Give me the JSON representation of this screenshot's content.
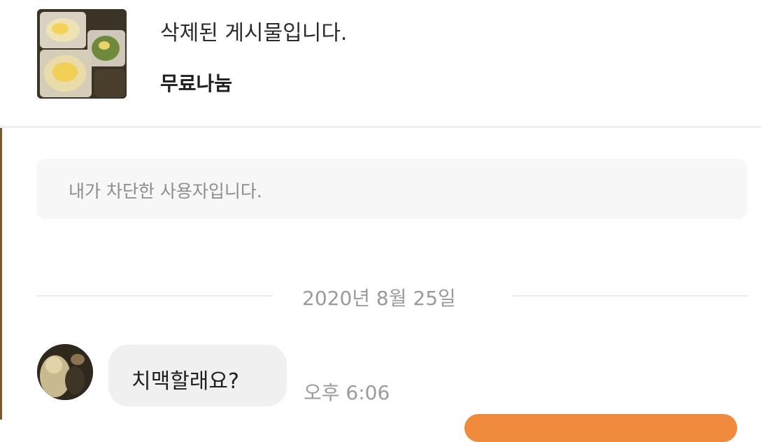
{
  "product": {
    "title": "삭제된 게시물입니다.",
    "price": "무료나눔"
  },
  "notice": {
    "blocked_text": "내가 차단한 사용자입니다."
  },
  "chat": {
    "date_separator": "2020년 8월 25일",
    "messages": [
      {
        "text": "치맥할래요?",
        "time": "오후 6:06",
        "direction": "incoming"
      }
    ]
  },
  "colors": {
    "accent": "#f08a3c",
    "bubble_incoming": "#f0f0f0",
    "notice_bg": "#f7f7f7",
    "muted_text": "#9a9a9a"
  }
}
